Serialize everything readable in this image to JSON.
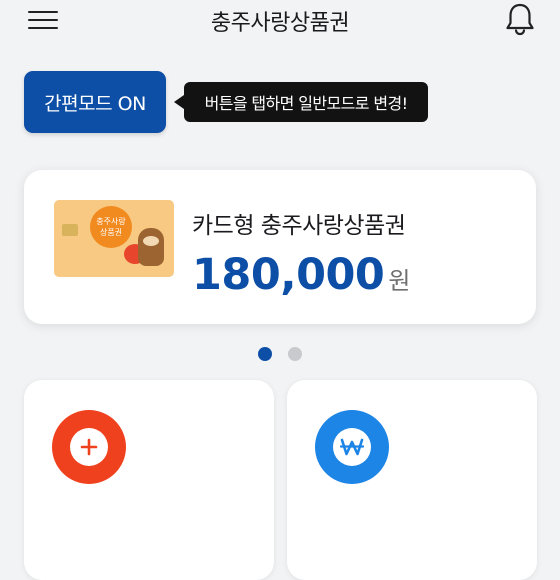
{
  "header": {
    "title": "충주사랑상품권",
    "menu_icon": "hamburger-menu-icon",
    "bell_icon": "bell-icon"
  },
  "easy_mode": {
    "button_label": "간편모드 ON",
    "tooltip": "버튼을 탭하면 일반모드로 변경!"
  },
  "card": {
    "name": "카드형 충주사랑상품권",
    "amount": "180,000",
    "unit": "원",
    "thumbnail": {
      "badge_line1": "충주사랑",
      "badge_line2": "상품권"
    }
  },
  "carousel": {
    "pages": 2,
    "active_index": 0
  },
  "tiles": [
    {
      "icon": "plus-icon",
      "color": "#f0411f"
    },
    {
      "icon": "won-icon",
      "color": "#1d85e6"
    }
  ],
  "colors": {
    "primary": "#0d4ea6",
    "background": "#f2f3f5"
  }
}
